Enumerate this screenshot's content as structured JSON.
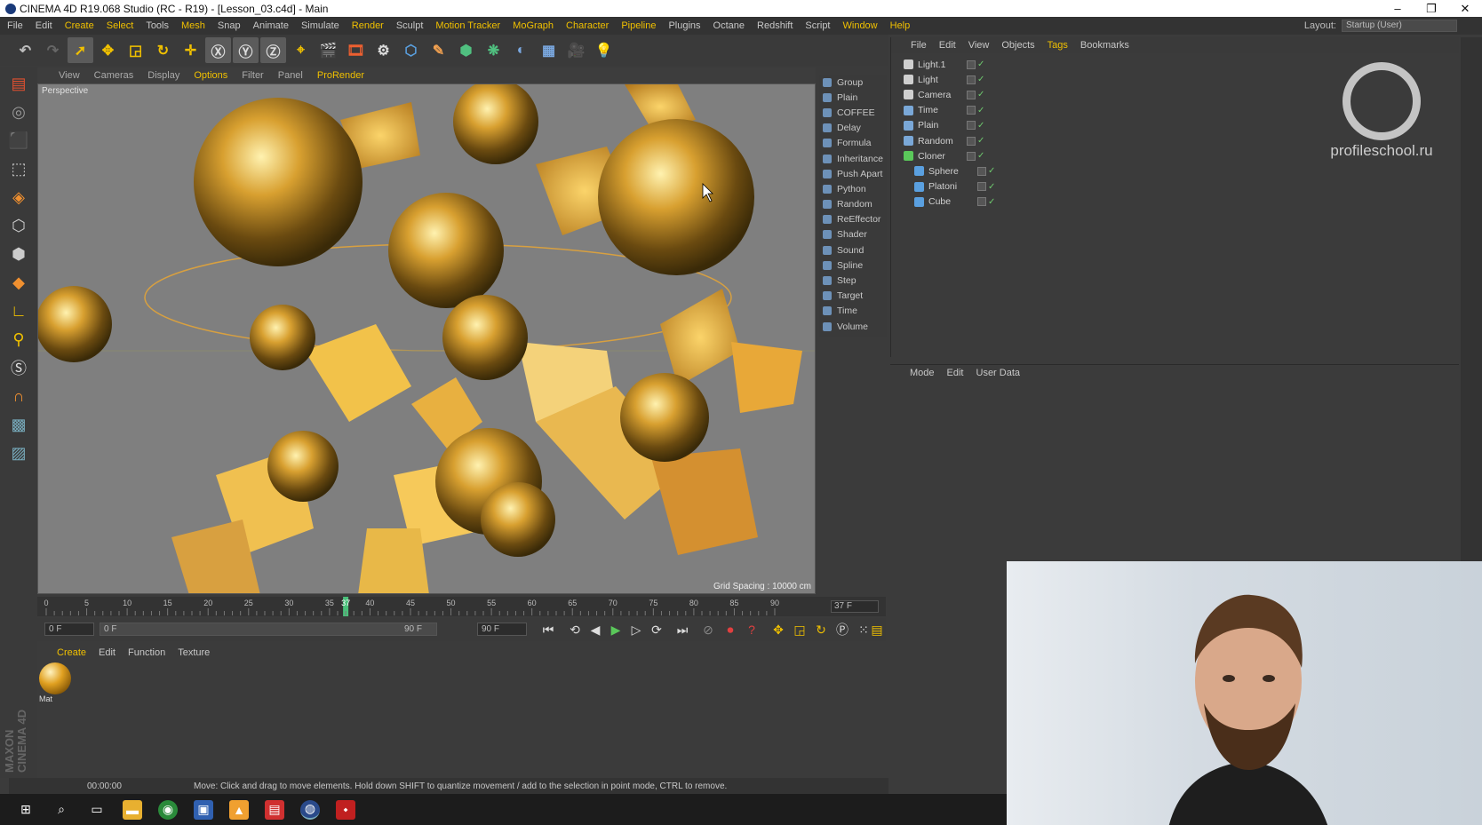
{
  "window": {
    "title": "CINEMA 4D R19.068 Studio (RC - R19) - [Lesson_03.c4d] - Main"
  },
  "menubar": {
    "items": [
      "File",
      "Edit",
      "Create",
      "Select",
      "Tools",
      "Mesh",
      "Snap",
      "Animate",
      "Simulate",
      "Render",
      "Sculpt",
      "Motion Tracker",
      "MoGraph",
      "Character",
      "Pipeline",
      "Plugins",
      "Octane",
      "Redshift",
      "Script",
      "Window",
      "Help"
    ],
    "layout_label": "Layout:",
    "layout_value": "Startup (User)"
  },
  "viewport": {
    "menu": [
      "View",
      "Cameras",
      "Display",
      "Options",
      "Filter",
      "Panel",
      "ProRender"
    ],
    "label": "Perspective",
    "grid_spacing": "Grid Spacing : 10000 cm"
  },
  "effectors": [
    "Group",
    "Plain",
    "COFFEE",
    "Delay",
    "Formula",
    "Inheritance",
    "Push Apart",
    "Python",
    "Random",
    "ReEffector",
    "Shader",
    "Sound",
    "Spline",
    "Step",
    "Target",
    "Time",
    "Volume"
  ],
  "timeline": {
    "ticks": [
      "0",
      "5",
      "10",
      "15",
      "20",
      "25",
      "30",
      "35",
      "37",
      "40",
      "45",
      "50",
      "55",
      "60",
      "65",
      "70",
      "75",
      "80",
      "85",
      "90"
    ],
    "current_frame": "37 F",
    "start_field": "0 F",
    "range_start": "0 F",
    "range_end": "90 F",
    "end_field": "90 F"
  },
  "material_manager": {
    "menu": [
      "Create",
      "Edit",
      "Function",
      "Texture"
    ],
    "materials": [
      {
        "name": "Mat"
      }
    ]
  },
  "status": {
    "time": "00:00:00",
    "message": "Move: Click and drag to move elements. Hold down SHIFT to quantize movement / add to the selection in point mode, CTRL to remove."
  },
  "object_manager": {
    "menu": [
      "File",
      "Edit",
      "View",
      "Objects",
      "Tags",
      "Bookmarks"
    ],
    "objects": [
      {
        "name": "Light.1",
        "icon": "light-icon"
      },
      {
        "name": "Light",
        "icon": "light-icon"
      },
      {
        "name": "Camera",
        "icon": "camera-icon"
      },
      {
        "name": "Time",
        "icon": "time-effector-icon"
      },
      {
        "name": "Plain",
        "icon": "plain-effector-icon"
      },
      {
        "name": "Random",
        "icon": "random-effector-icon"
      },
      {
        "name": "Cloner",
        "icon": "cloner-icon"
      },
      {
        "name": "Sphere",
        "icon": "sphere-icon"
      },
      {
        "name": "Platoni",
        "icon": "platonic-icon"
      },
      {
        "name": "Cube",
        "icon": "cube-icon"
      }
    ]
  },
  "attribute_manager": {
    "menu": [
      "Mode",
      "Edit",
      "User Data"
    ]
  },
  "watermark": {
    "text": "profileschool.ru"
  },
  "colors": {
    "accent": "#f0c000",
    "viewport_bg": "#7f7f7f",
    "gold": "#e0a020"
  }
}
